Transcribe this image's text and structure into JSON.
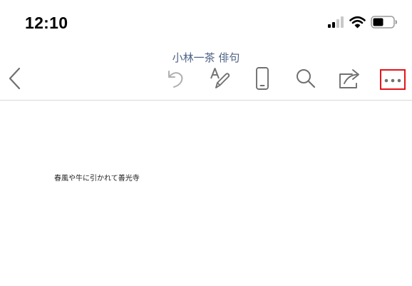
{
  "status_bar": {
    "time": "12:10",
    "icons": [
      "signal-icon",
      "wifi-icon",
      "battery-icon"
    ]
  },
  "document": {
    "title": "小林一茶 俳句",
    "body_text": "春風や牛に引かれて善光寺"
  },
  "toolbar": {
    "buttons": [
      "back-icon",
      "undo-icon",
      "format-pen-icon",
      "mobile-view-icon",
      "search-icon",
      "share-icon",
      "more-icon"
    ]
  },
  "colors": {
    "title": "#4c6286",
    "icon": "#707070",
    "icon_disabled": "#b0b0b0",
    "highlight": "#e3141b"
  }
}
